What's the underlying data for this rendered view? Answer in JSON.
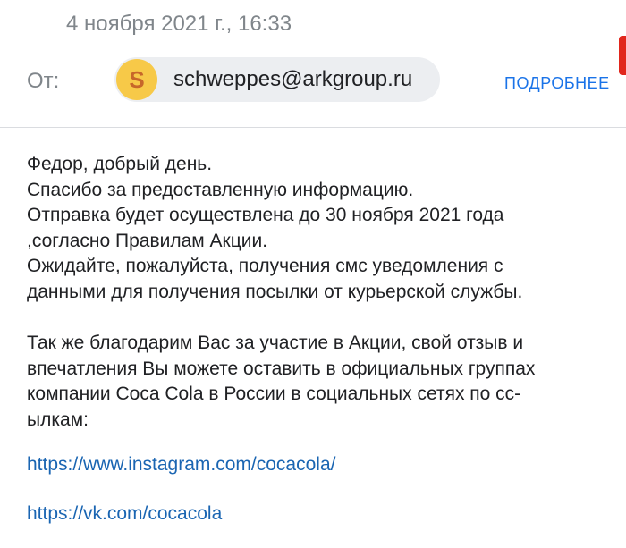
{
  "header": {
    "date": "4 ноября 2021 г., 16:33",
    "from_label": "От:",
    "sender": {
      "avatar_letter": "S",
      "email": "schweppes@arkgroup.ru"
    },
    "details_label": "ПОДРОБНЕЕ"
  },
  "message": {
    "paragraph1": [
      "Федор, добрый день.",
      "Спасибо за предоставленную информацию.",
      "Отправка будет осуществлена до 30 ноября 2021 года",
      ",согласно Правилам Акции.",
      "Ожидайте, пожалуйста, получения смс уведомления с",
      "данными для получения посылки от курьерской службы."
    ],
    "paragraph2": [
      "Так же благодарим Вас за участие в Акции, свой отзыв и",
      "впечатления Вы можете оставить в официальных группах",
      "компании Coca Cola в России в социальных сетях по сс-",
      "ылкам:"
    ],
    "links": [
      "https://www.instagram.com/cocacola/",
      "https://vk.com/cocacola"
    ]
  },
  "colors": {
    "accent_link": "#1a73e8",
    "avatar_bg": "#f7c948",
    "avatar_fg": "#c7672a",
    "muted_text": "#80868b"
  }
}
